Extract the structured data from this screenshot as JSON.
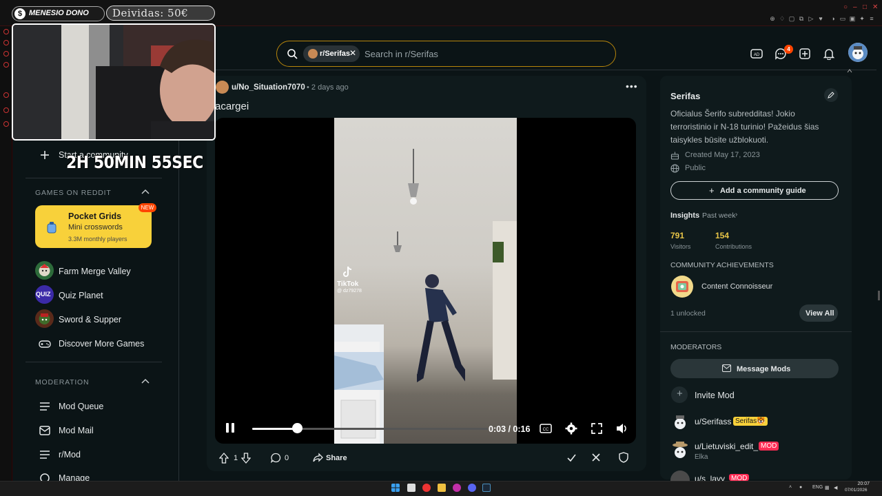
{
  "overlay": {
    "donor_label": "MENESIO DONO",
    "debt_label": "Deividas: 50€",
    "timer": "2H 50MIN 55SEC"
  },
  "header": {
    "search_chip": "r/Serifas",
    "search_placeholder": "Search in r/Serifas",
    "chat_badge": "4"
  },
  "leftnav": {
    "start_community": "Start a community",
    "games_header": "GAMES ON REDDIT",
    "pocket": {
      "title": "Pocket Grids",
      "subtitle": "Mini crosswords",
      "players": "3.3M monthly players",
      "badge": "NEW"
    },
    "games": [
      "Farm Merge Valley",
      "Quiz Planet",
      "Sword & Supper",
      "Discover More Games"
    ],
    "quiz_badge": "QUIZ",
    "moderation_header": "MODERATION",
    "mod_items": [
      "Mod Queue",
      "Mod Mail",
      "r/Mod",
      "Manage"
    ]
  },
  "post": {
    "author": "u/No_Situation7070",
    "time": "• 2 days ago",
    "title": "acargei",
    "watermark_brand": "TikTok",
    "watermark_user": "@ dz79278",
    "video_time": "0:03 / 0:16",
    "progress": 0.19,
    "votes": "1",
    "comments": "0",
    "share_label": "Share"
  },
  "sidebar": {
    "name": "Serifas",
    "description": "Oficialus Šerifo subredditas! Jokio terroristinio ir N-18 turinio! Pažeidus šias taisykles būsite užblokuoti.",
    "created": "Created May 17, 2023",
    "visibility": "Public",
    "guide_button": "Add a community guide",
    "insights_label": "Insights",
    "insights_range": "Past week",
    "visitors_value": "791",
    "visitors_label": "Visitors",
    "contrib_value": "154",
    "contrib_label": "Contributions",
    "achievements_header": "COMMUNITY ACHIEVEMENTS",
    "achievement_name": "Content Connoisseur",
    "unlocked": "1 unlocked",
    "view_all": "View All",
    "moderators_header": "MODERATORS",
    "message_mods": "Message Mods",
    "invite_mod": "Invite Mod",
    "mods": [
      {
        "name": "u/Serifass",
        "flair": "Serifas🐯"
      },
      {
        "name": "u/Lietuviski_edit_",
        "flair": "MOD",
        "sub": "Elka"
      },
      {
        "name": "u/s_lavy",
        "flair": "MOD"
      }
    ]
  },
  "taskbar": {
    "lang": "ENG",
    "time": "20:07",
    "date": "07/01/2026"
  },
  "colors": {
    "accent": "#ff4500",
    "pocket_card": "#f8d13a",
    "search_border": "#b8860b",
    "serifas_flair": "#f8d13a",
    "mod_flair": "#ff2d55"
  }
}
